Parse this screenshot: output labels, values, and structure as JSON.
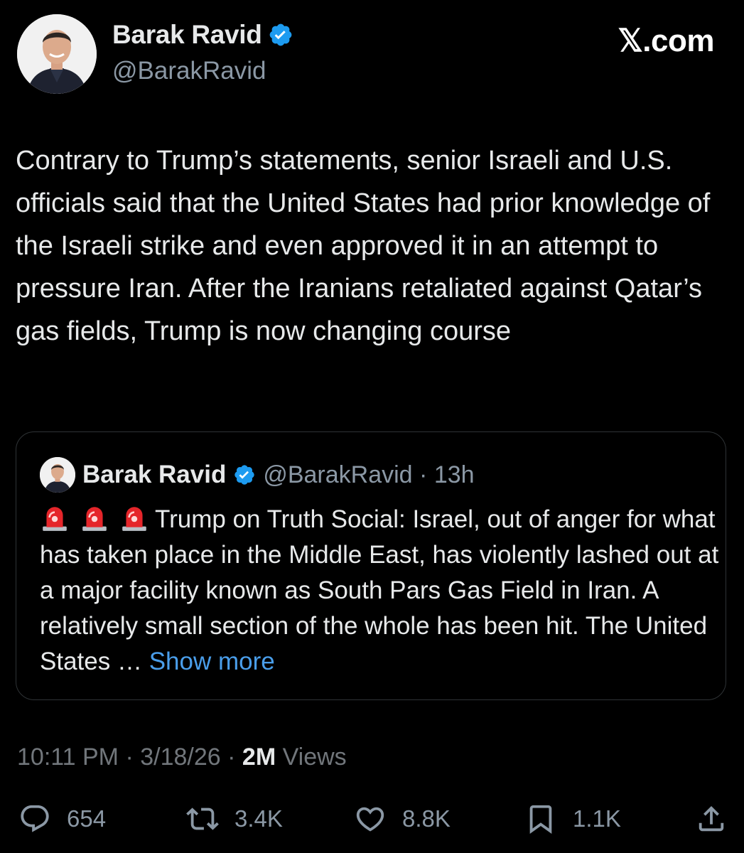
{
  "author": {
    "name": "Barak Ravid",
    "handle": "@BarakRavid",
    "verified": true
  },
  "brand": "𝕏.com",
  "tweet": {
    "text": "Contrary to Trump’s statements, senior Israeli and U.S. officials said that the United States had prior knowledge of the Israeli strike and even approved it in an attempt to pressure Iran. After the Iranians retaliated against Qatar’s gas fields, Trump is now changing course"
  },
  "quote": {
    "name": "Barak Ravid",
    "handle": "@BarakRavid",
    "time": "13h",
    "emojis": [
      "police-siren",
      "police-siren",
      "police-siren"
    ],
    "text": "Trump on Truth Social: Israel, out of anger for what has taken place in the Middle East, has violently lashed out at a major facility known as South Pars Gas Field in Iran. A relatively small section of the whole has been hit. The United States …",
    "show_more": "Show more"
  },
  "meta": {
    "time": "10:11 PM",
    "date": "3/18/26",
    "views_count": "2M",
    "views_label": "Views"
  },
  "actions": {
    "replies": "654",
    "reposts": "3.4K",
    "likes": "8.8K",
    "bookmarks": "1.1K"
  },
  "colors": {
    "background": "#000000",
    "text": "#e7e9ea",
    "secondary": "#8b98a5",
    "link": "#4a9eea",
    "verified": "#1d9bf0",
    "border": "#2f3336"
  }
}
